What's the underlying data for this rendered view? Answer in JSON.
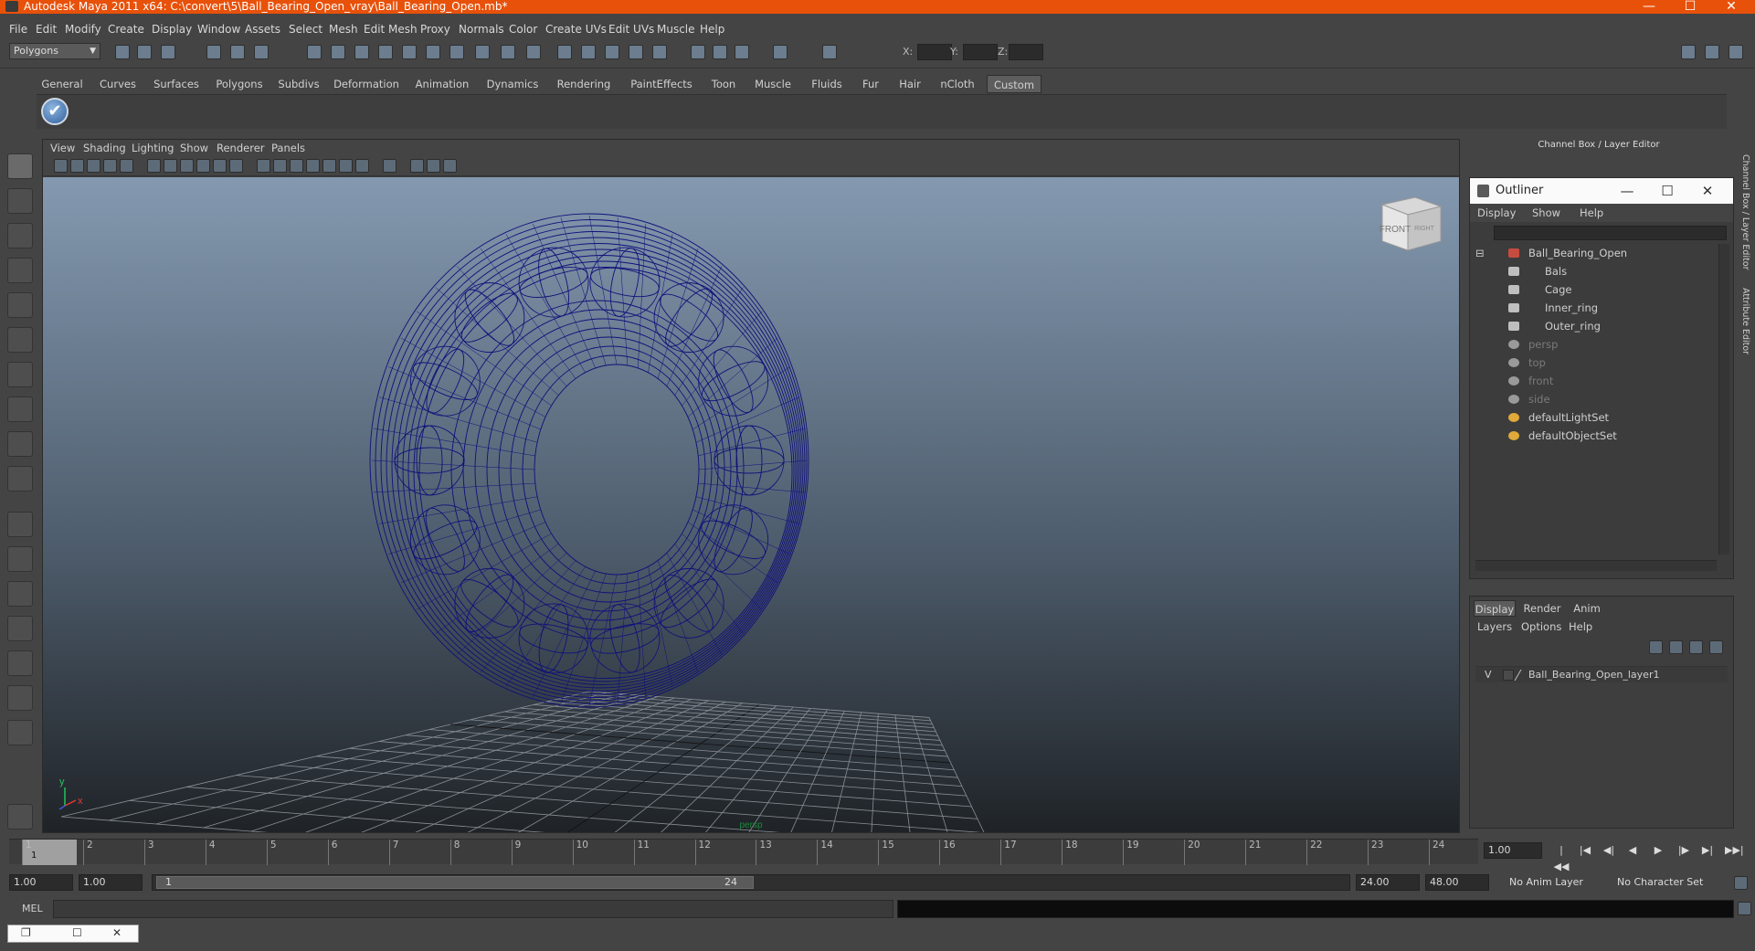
{
  "window": {
    "title": "Autodesk Maya 2011 x64: C:\\convert\\5\\Ball_Bearing_Open_vray\\Ball_Bearing_Open.mb*",
    "minimize": "—",
    "maximize": "☐",
    "close": "✕"
  },
  "menubar": [
    "File",
    "Edit",
    "Modify",
    "Create",
    "Display",
    "Window",
    "Assets",
    "Select",
    "Mesh",
    "Edit Mesh",
    "Proxy",
    "Normals",
    "Color",
    "Create UVs",
    "Edit UVs",
    "Muscle",
    "Help"
  ],
  "status": {
    "mode": "Polygons",
    "x_label": "X:",
    "y_label": "Y:",
    "z_label": "Z:"
  },
  "shelf": {
    "tabs": [
      "General",
      "Curves",
      "Surfaces",
      "Polygons",
      "Subdivs",
      "Deformation",
      "Animation",
      "Dynamics",
      "Rendering",
      "PaintEffects",
      "Toon",
      "Muscle",
      "Fluids",
      "Fur",
      "Hair",
      "nCloth",
      "Custom"
    ],
    "active_tab": "Custom",
    "button_glyph": "✔"
  },
  "viewport": {
    "menu": [
      "View",
      "Shading",
      "Lighting",
      "Show",
      "Renderer",
      "Panels"
    ],
    "viewcube_front": "FRONT",
    "viewcube_right": "RIGHT",
    "axis_x": "x",
    "axis_y": "y",
    "camera_label": "persp"
  },
  "right_panel": {
    "header": "Channel Box / Layer Editor",
    "side_tabs": [
      "Channel Box / Layer Editor",
      "Attribute Editor"
    ]
  },
  "outliner": {
    "title": "Outliner",
    "menu": [
      "Display",
      "Show",
      "Help"
    ],
    "items": [
      {
        "label": "Ball_Bearing_Open",
        "level": 0,
        "kind": "group",
        "dim": false
      },
      {
        "label": "Bals",
        "level": 1,
        "kind": "mesh",
        "dim": false
      },
      {
        "label": "Cage",
        "level": 1,
        "kind": "mesh",
        "dim": false
      },
      {
        "label": "Inner_ring",
        "level": 1,
        "kind": "mesh",
        "dim": false
      },
      {
        "label": "Outer_ring",
        "level": 1,
        "kind": "mesh",
        "dim": false
      },
      {
        "label": "persp",
        "level": 0,
        "kind": "camera",
        "dim": true
      },
      {
        "label": "top",
        "level": 0,
        "kind": "camera",
        "dim": true
      },
      {
        "label": "front",
        "level": 0,
        "kind": "camera",
        "dim": true
      },
      {
        "label": "side",
        "level": 0,
        "kind": "camera",
        "dim": true
      },
      {
        "label": "defaultLightSet",
        "level": 0,
        "kind": "set",
        "dim": false
      },
      {
        "label": "defaultObjectSet",
        "level": 0,
        "kind": "set",
        "dim": false
      }
    ]
  },
  "layers": {
    "tabs": [
      "Display",
      "Render",
      "Anim"
    ],
    "active_tab": "Display",
    "menu": [
      "Layers",
      "Options",
      "Help"
    ],
    "rows": [
      {
        "visible": "V",
        "name": "Ball_Bearing_Open_layer1"
      }
    ]
  },
  "timeline": {
    "ticks": [
      "1",
      "2",
      "3",
      "4",
      "5",
      "6",
      "7",
      "8",
      "9",
      "10",
      "11",
      "12",
      "13",
      "14",
      "15",
      "16",
      "17",
      "18",
      "19",
      "20",
      "21",
      "22",
      "23",
      "24"
    ],
    "current_frame": "1",
    "current_time": "1.00",
    "controls": [
      "|◀◀",
      "|◀",
      "◀|",
      "◀",
      "▶",
      "|▶",
      "▶|",
      "▶▶|"
    ]
  },
  "range": {
    "start_time": "1.00",
    "playback_start": "1.00",
    "slider_start": "1",
    "slider_end": "24",
    "playback_end": "24.00",
    "end_time": "48.00",
    "anim_layer": "No Anim Layer",
    "character_set": "No Character Set"
  },
  "command": {
    "label": "MEL"
  },
  "minimized": {
    "restore": "❐",
    "maximize": "☐",
    "close": "✕"
  }
}
